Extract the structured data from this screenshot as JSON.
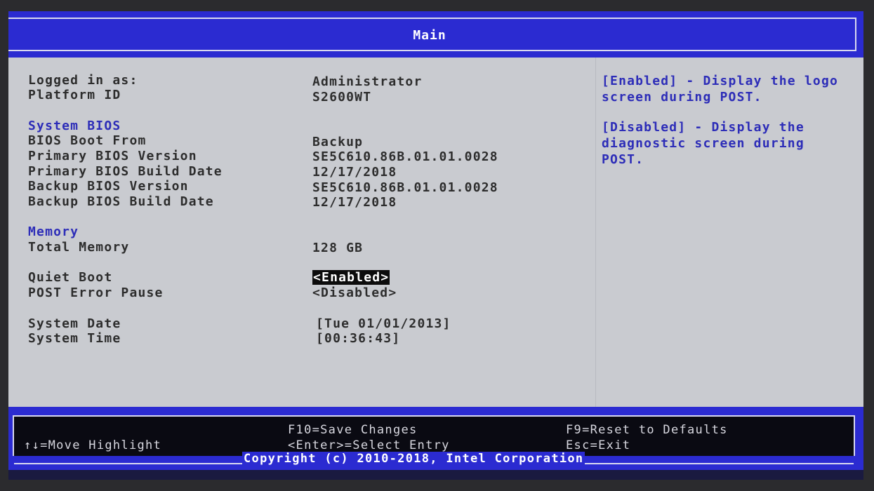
{
  "title": "Main",
  "fields": {
    "logged_in_as": {
      "label": "Logged in as:",
      "value": "Administrator"
    },
    "platform_id": {
      "label": "Platform ID",
      "value": "S2600WT"
    },
    "system_bios_header": "System BIOS",
    "bios_boot_from": {
      "label": "BIOS Boot From",
      "value": "Backup"
    },
    "primary_bios_version": {
      "label": "Primary BIOS Version",
      "value": "SE5C610.86B.01.01.0028"
    },
    "primary_bios_build_date": {
      "label": "Primary BIOS Build Date",
      "value": "12/17/2018"
    },
    "backup_bios_version": {
      "label": "Backup BIOS Version",
      "value": "SE5C610.86B.01.01.0028"
    },
    "backup_bios_build_date": {
      "label": "Backup BIOS Build Date",
      "value": "12/17/2018"
    },
    "memory_header": "Memory",
    "total_memory": {
      "label": "Total Memory",
      "value": "128 GB"
    },
    "quiet_boot": {
      "label": "Quiet Boot",
      "value": "<Enabled>"
    },
    "post_error_pause": {
      "label": "POST Error Pause",
      "value": "<Disabled>"
    },
    "system_date": {
      "label": "System Date",
      "value": "[Tue 01/01/2013]"
    },
    "system_time": {
      "label": "System Time",
      "value": "[00:36:43]"
    }
  },
  "help": {
    "enabled_text": "[Enabled] - Display the logo screen during POST.",
    "disabled_text": "[Disabled] - Display the diagnostic screen during POST."
  },
  "footer": {
    "move": "↑↓=Move Highlight",
    "save": "F10=Save Changes",
    "select": "<Enter>=Select Entry",
    "reset": "F9=Reset to Defaults",
    "exit": "Esc=Exit",
    "copyright": "Copyright (c) 2010-2018, Intel Corporation"
  },
  "colors": {
    "title_bar": "#2b2bd1",
    "body_bg": "#c9cbd0",
    "header_text": "#2d2db8",
    "label_text": "#2d2d2d",
    "footer_bg": "#0a0a12"
  }
}
